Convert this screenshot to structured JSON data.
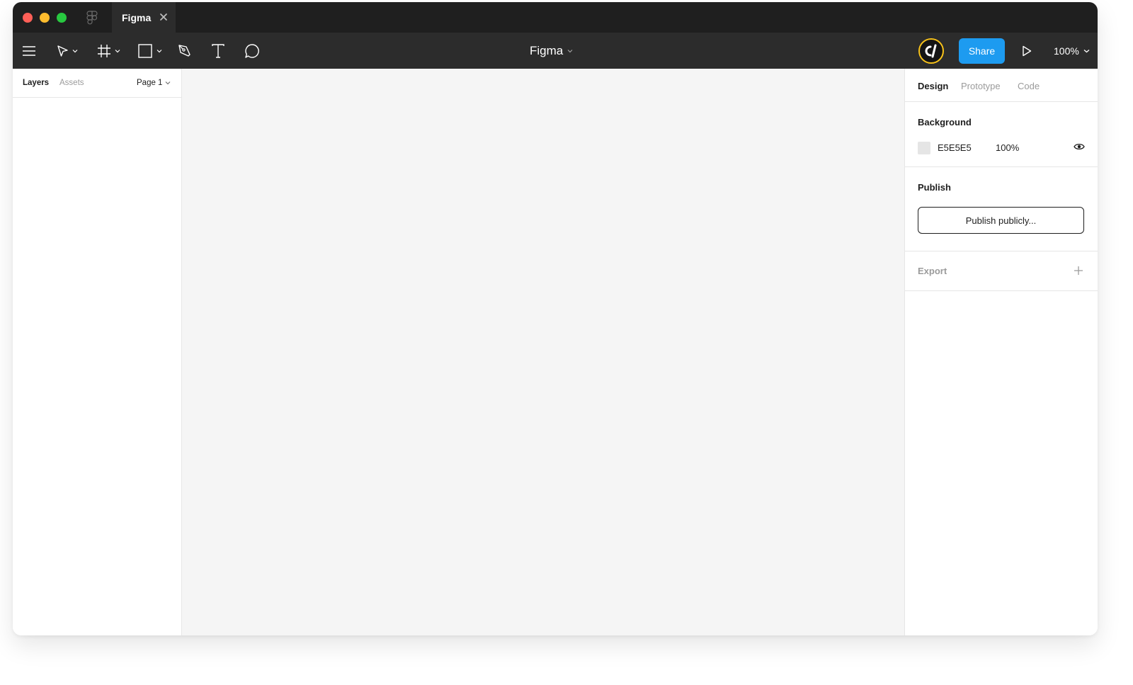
{
  "window": {
    "tab_title": "Figma"
  },
  "toolbar": {
    "doc_title": "Figma",
    "avatar_initials": "cl",
    "share_label": "Share",
    "zoom_label": "100%"
  },
  "left_panel": {
    "tabs": [
      {
        "label": "Layers",
        "active": true
      },
      {
        "label": "Assets",
        "active": false
      }
    ],
    "page_select": "Page 1"
  },
  "right_panel": {
    "tabs": [
      {
        "label": "Design",
        "active": true
      },
      {
        "label": "Prototype",
        "active": false
      },
      {
        "label": "Code",
        "active": false
      }
    ],
    "background": {
      "title": "Background",
      "hex": "E5E5E5",
      "opacity": "100%"
    },
    "publish": {
      "title": "Publish",
      "button_label": "Publish publicly..."
    },
    "export": {
      "title": "Export"
    }
  },
  "colors": {
    "toolbar_bg": "#2c2c2c",
    "titlebar_bg": "#1f1f1f",
    "share_blue": "#1d9bf0",
    "canvas_bg": "#f5f5f5",
    "avatar_ring": "#f7c21a"
  }
}
